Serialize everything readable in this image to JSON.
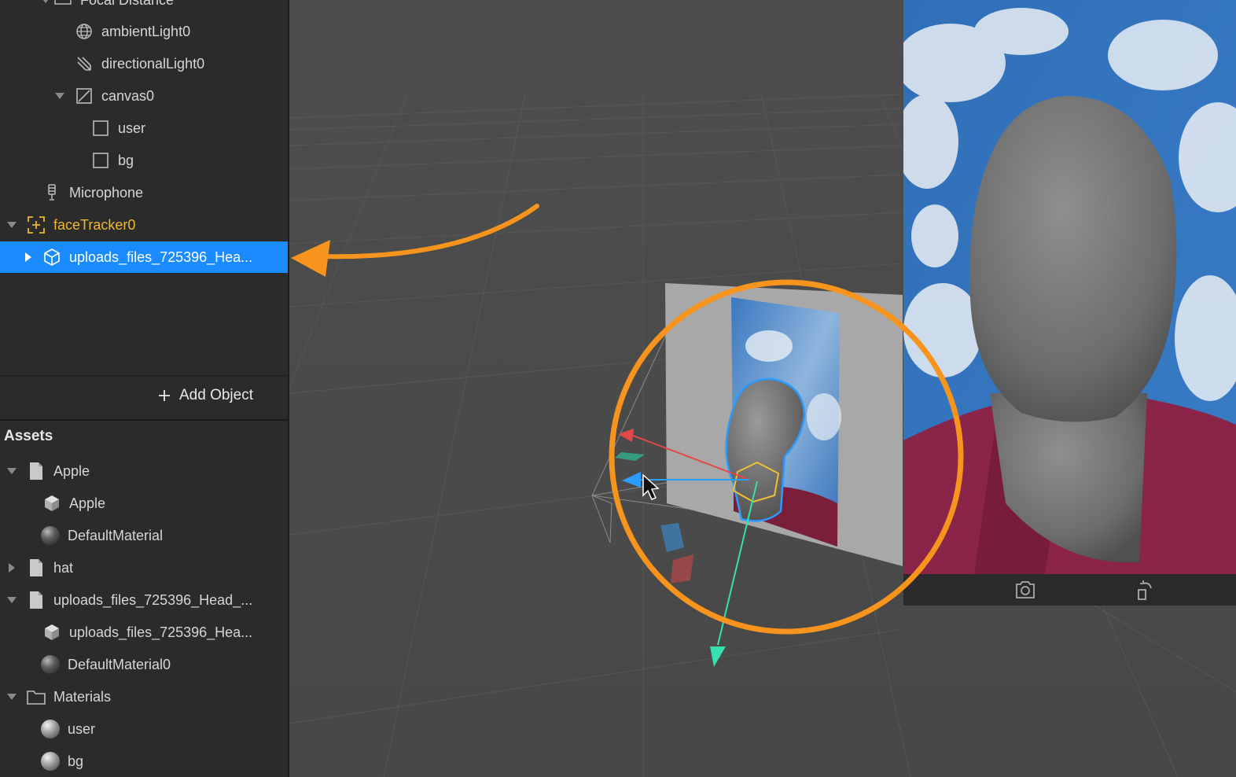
{
  "scene": {
    "items": [
      {
        "label": "Focal Distance",
        "icon": "ruler-icon"
      },
      {
        "label": "ambientLight0",
        "icon": "globe-icon"
      },
      {
        "label": "directionalLight0",
        "icon": "directional-light-icon"
      },
      {
        "label": "canvas0",
        "icon": "canvas-icon"
      },
      {
        "label": "user",
        "icon": "rectangle-icon"
      },
      {
        "label": "bg",
        "icon": "rectangle-icon"
      },
      {
        "label": "Microphone",
        "icon": "microphone-icon"
      },
      {
        "label": "faceTracker0",
        "icon": "face-tracker-icon"
      },
      {
        "label": "uploads_files_725396_Hea...",
        "icon": "cube-icon",
        "selected": true
      }
    ],
    "add_object_label": "Add Object"
  },
  "assets": {
    "title": "Assets",
    "items": [
      {
        "label": "Apple",
        "icon": "file-icon"
      },
      {
        "label": "Apple",
        "icon": "mesh-icon"
      },
      {
        "label": "DefaultMaterial",
        "icon": "material-sphere-icon"
      },
      {
        "label": "hat",
        "icon": "file-icon"
      },
      {
        "label": "uploads_files_725396_Head_...",
        "icon": "file-icon"
      },
      {
        "label": "uploads_files_725396_Hea...",
        "icon": "mesh-icon"
      },
      {
        "label": "DefaultMaterial0",
        "icon": "material-sphere-icon"
      },
      {
        "label": "Materials",
        "icon": "folder-icon"
      },
      {
        "label": "user",
        "icon": "material-sphere-icon"
      },
      {
        "label": "bg",
        "icon": "material-sphere-icon"
      }
    ]
  },
  "preview": {
    "toolbar": [
      {
        "icon": "camera-switch-icon"
      },
      {
        "icon": "rotate-device-icon"
      }
    ]
  },
  "colors": {
    "selection": "#1a8cff",
    "highlight_annotation": "#f7941d",
    "face_tracker": "#f0b830"
  }
}
